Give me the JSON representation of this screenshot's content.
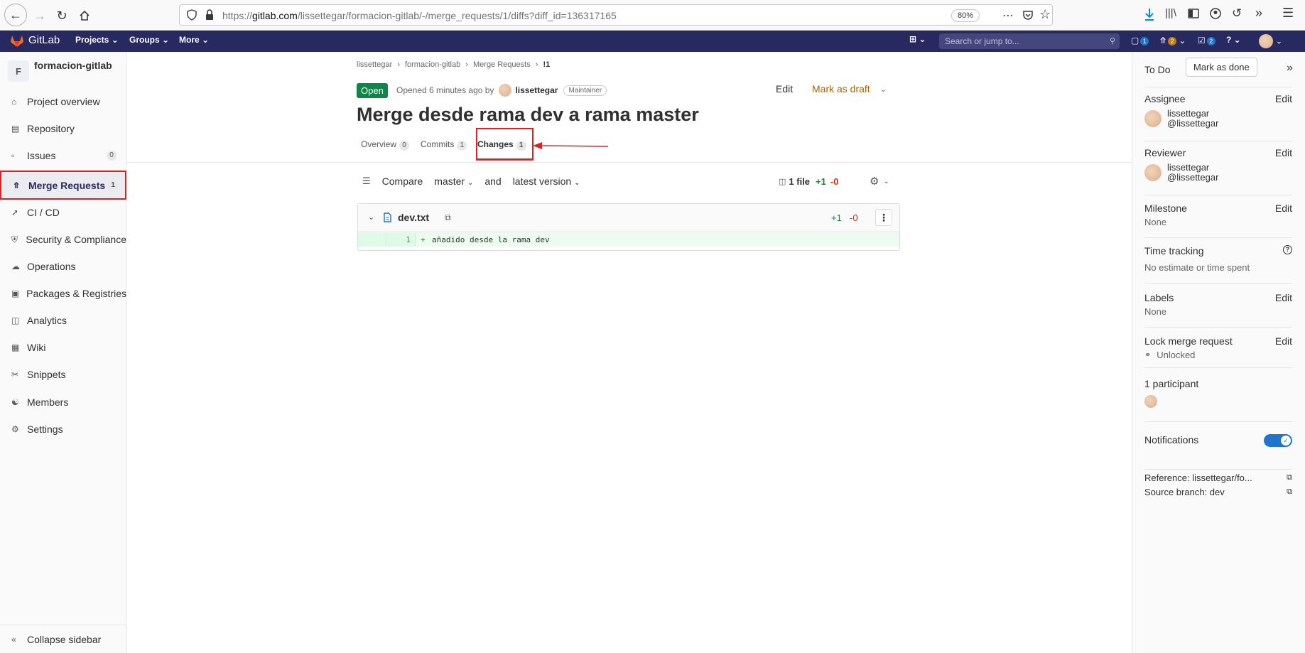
{
  "browser": {
    "url_prefix": "https://",
    "url_host": "gitlab.com",
    "url_path": "/lissettegar/formacion-gitlab/-/merge_requests/1/diffs?diff_id=136317165",
    "zoom": "80%"
  },
  "topnav": {
    "brand": "GitLab",
    "projects": "Projects",
    "groups": "Groups",
    "more": "More",
    "search_placeholder": "Search or jump to...",
    "mr_count": "1",
    "issues_count": "2",
    "todo_count": "2"
  },
  "sidebar": {
    "project_initial": "F",
    "project_name": "formacion-gitlab",
    "items": [
      {
        "label": "Project overview",
        "icon": "home-icon"
      },
      {
        "label": "Repository",
        "icon": "book-icon"
      },
      {
        "label": "Issues",
        "icon": "issues-icon",
        "count": "0"
      },
      {
        "label": "Merge Requests",
        "icon": "merge-request-icon",
        "count": "1"
      },
      {
        "label": "CI / CD",
        "icon": "rocket-icon"
      },
      {
        "label": "Security & Compliance",
        "icon": "shield-icon"
      },
      {
        "label": "Operations",
        "icon": "cloud-icon"
      },
      {
        "label": "Packages & Registries",
        "icon": "package-icon"
      },
      {
        "label": "Analytics",
        "icon": "chart-icon"
      },
      {
        "label": "Wiki",
        "icon": "wiki-icon"
      },
      {
        "label": "Snippets",
        "icon": "scissors-icon"
      },
      {
        "label": "Members",
        "icon": "users-icon"
      },
      {
        "label": "Settings",
        "icon": "gear-icon"
      }
    ],
    "collapse": "Collapse sidebar"
  },
  "breadcrumb": [
    "lissettegar",
    "formacion-gitlab",
    "Merge Requests",
    "!1"
  ],
  "mr": {
    "status": "Open",
    "opened_text": "Opened 6 minutes ago by",
    "author": "lissettegar",
    "role": "Maintainer",
    "edit": "Edit",
    "mark_draft": "Mark as draft",
    "title": "Merge desde rama dev a rama master",
    "tabs": [
      {
        "label": "Overview",
        "count": "0"
      },
      {
        "label": "Commits",
        "count": "1"
      },
      {
        "label": "Changes",
        "count": "1"
      }
    ]
  },
  "compare": {
    "compare_label": "Compare",
    "base": "master",
    "and": "and",
    "head": "latest version",
    "files": "1 file",
    "additions": "+1",
    "deletions": "-0"
  },
  "diff": {
    "filename": "dev.txt",
    "additions": "+1",
    "deletions": "-0",
    "line_number": "1",
    "line_sign": "+",
    "line_text": "añadido desde la rama dev"
  },
  "rightbar": {
    "todo": "To Do",
    "mark_done": "Mark as done",
    "assignee_title": "Assignee",
    "assignee_name": "lissettegar",
    "assignee_handle": "@lissettegar",
    "reviewer_title": "Reviewer",
    "reviewer_name": "lissettegar",
    "reviewer_handle": "@lissettegar",
    "milestone_title": "Milestone",
    "milestone_value": "None",
    "time_title": "Time tracking",
    "time_value": "No estimate or time spent",
    "labels_title": "Labels",
    "labels_value": "None",
    "lock_title": "Lock merge request",
    "lock_value": "Unlocked",
    "participants": "1 participant",
    "notifications": "Notifications",
    "reference": "Reference: lissettegar/fo...",
    "source_branch": "Source branch: dev",
    "edit": "Edit"
  },
  "colors": {
    "navbar": "#292961",
    "open_badge": "#108548",
    "annotation": "#e02020",
    "addition": "#108548",
    "deletion": "#dd2b0e"
  }
}
